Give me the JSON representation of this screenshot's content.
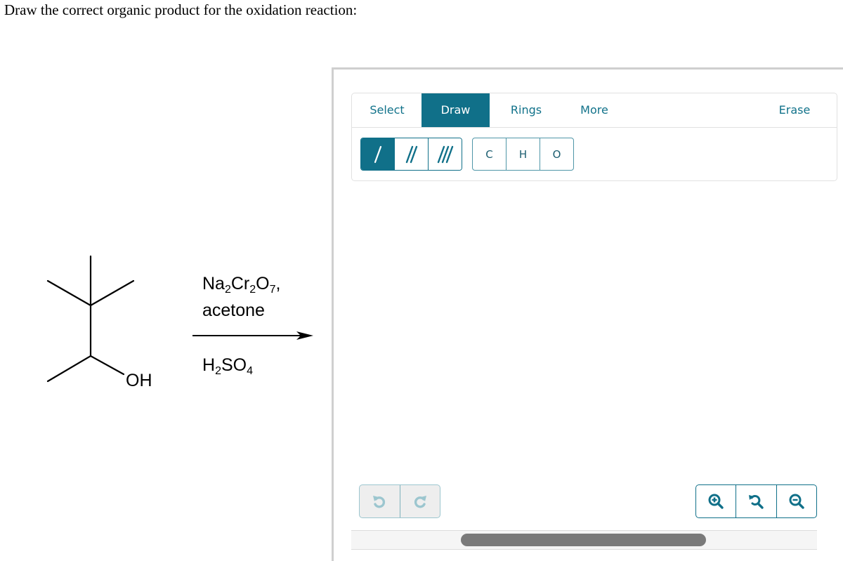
{
  "question": {
    "prompt": "Draw the correct organic product for the oxidation reaction:"
  },
  "reaction": {
    "reactant_label": "OH",
    "reagents_above": [
      {
        "parts": [
          "Na",
          "2",
          "Cr",
          "2",
          "O",
          "7",
          ","
        ]
      },
      {
        "text": "acetone"
      }
    ],
    "reagents_below": [
      {
        "parts": [
          "H",
          "2",
          "SO",
          "4"
        ]
      }
    ],
    "arrow": "right-arrow"
  },
  "editor": {
    "tabs": [
      {
        "label": "Select",
        "active": false
      },
      {
        "label": "Draw",
        "active": true
      },
      {
        "label": "Rings",
        "active": false
      },
      {
        "label": "More",
        "active": false
      },
      {
        "label": "Erase",
        "active": false
      }
    ],
    "bond_tools": [
      {
        "name": "single-bond",
        "active": true
      },
      {
        "name": "double-bond",
        "active": false
      },
      {
        "name": "triple-bond",
        "active": false
      }
    ],
    "atom_tools": [
      "C",
      "H",
      "O"
    ],
    "history_controls": [
      "undo-icon",
      "redo-icon"
    ],
    "zoom_controls": [
      "zoom-in-icon",
      "reset-zoom-icon",
      "zoom-out-icon"
    ],
    "colors": {
      "accent": "#107089",
      "tab_text": "#11728a",
      "disabled_icon": "#9cc6cf",
      "scroll_thumb": "#7a7a7a"
    }
  }
}
